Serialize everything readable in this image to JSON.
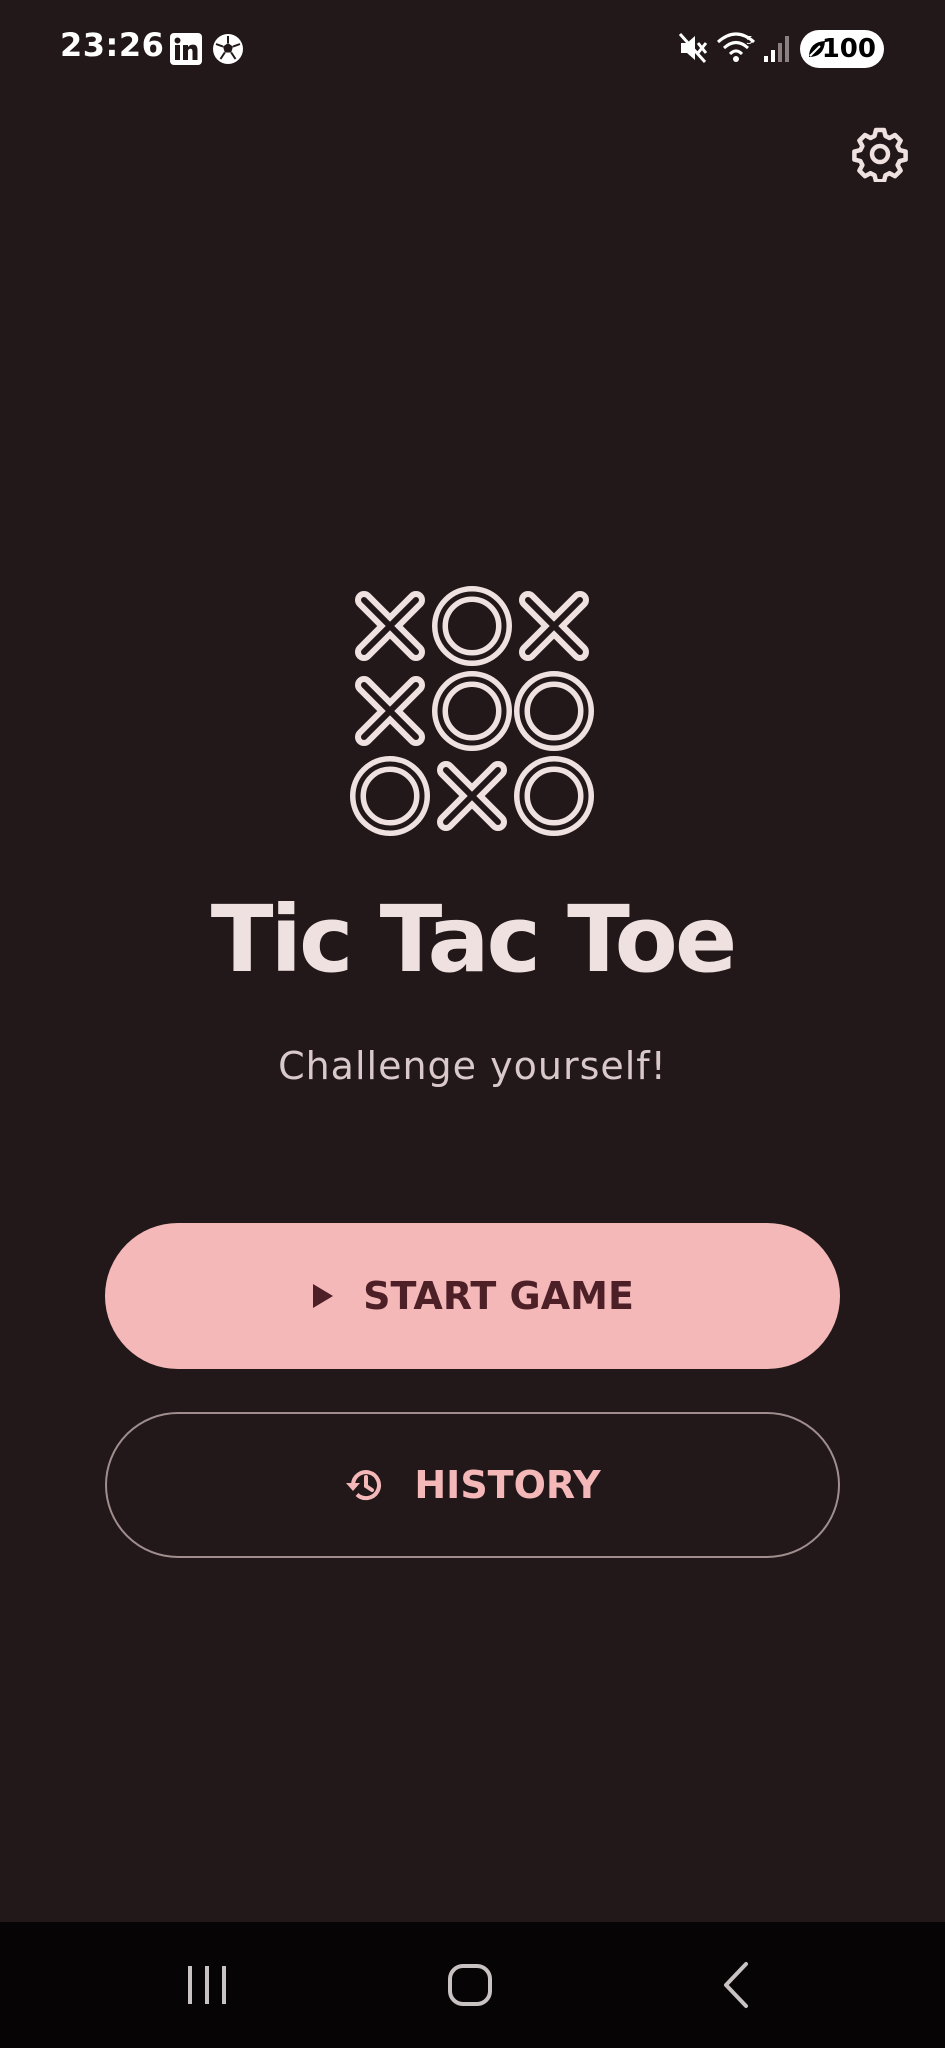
{
  "status_bar": {
    "time": "23:26",
    "notification_icons": [
      "linkedin-icon",
      "soccer-ball-icon"
    ],
    "system_icons": [
      "mute-icon",
      "wifi-icon",
      "signal-icon"
    ],
    "battery": "100"
  },
  "header": {
    "settings_icon": "gear-icon"
  },
  "app": {
    "logo_grid": [
      [
        "X",
        "O",
        "X"
      ],
      [
        "X",
        "O",
        "O"
      ],
      [
        "O",
        "X",
        "O"
      ]
    ],
    "title": "Tic Tac Toe",
    "subtitle": "Challenge yourself!"
  },
  "buttons": {
    "start_label": "START GAME",
    "start_icon": "play-icon",
    "history_label": "HISTORY",
    "history_icon": "history-icon"
  },
  "nav": {
    "items": [
      "recent-apps-icon",
      "home-icon",
      "back-icon"
    ]
  },
  "colors": {
    "background": "#221819",
    "primary": "#f5b8b9",
    "on_primary": "#4c2026",
    "title": "#f0e1e1"
  }
}
